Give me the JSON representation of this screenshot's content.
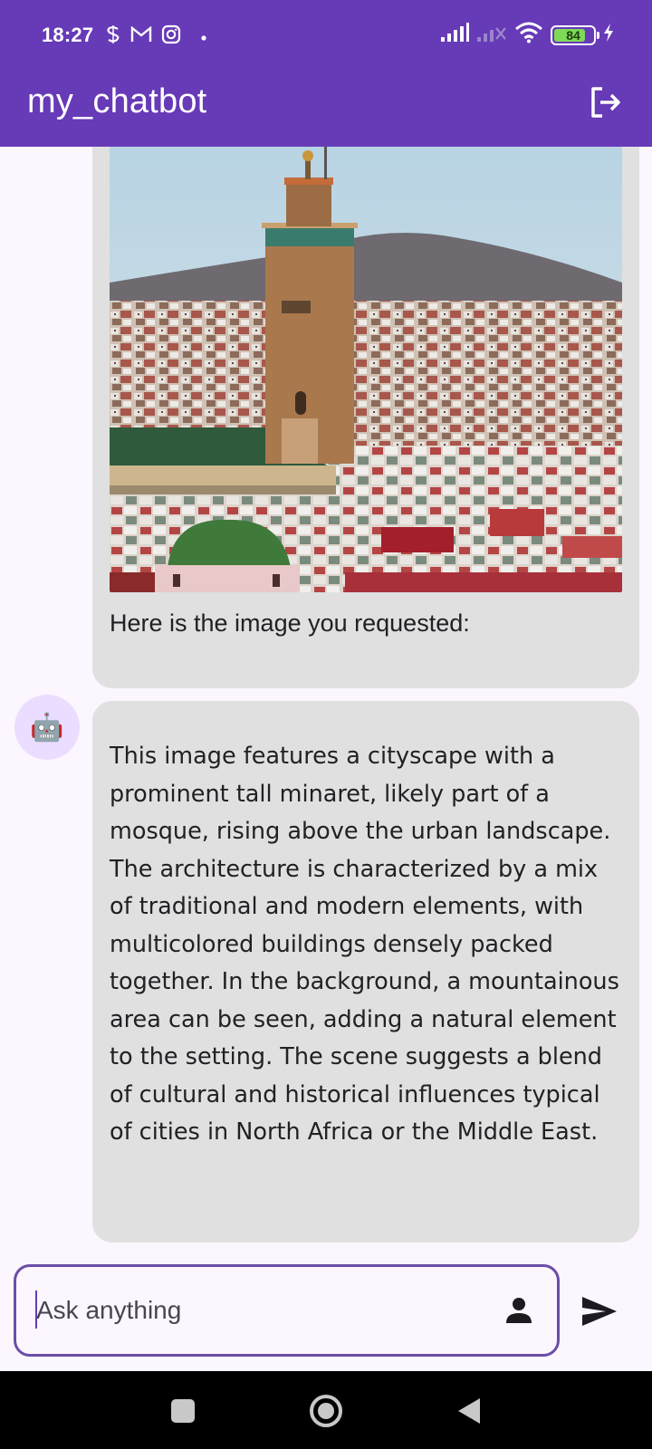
{
  "status_bar": {
    "time": "18:27",
    "battery_level": "84",
    "left_icons": [
      "s-icon",
      "gmail-icon",
      "instagram-icon",
      "dot-icon"
    ],
    "right_icons": [
      "signal-icon",
      "signal-off-icon",
      "wifi-icon",
      "battery-icon",
      "charging-icon"
    ]
  },
  "app_bar": {
    "title": "my_chatbot",
    "logout_icon": "logout-icon"
  },
  "messages": [
    {
      "role": "bot",
      "image": "generated-image",
      "caption": "Here is the image you requested:"
    },
    {
      "role": "bot",
      "avatar": "🤖",
      "text": "This image features a cityscape with a prominent tall minaret, likely part of a mosque, rising above the urban landscape. The architecture is characterized by a mix of traditional and modern elements, with multicolored buildings densely packed together. In the background, a mountainous area can be seen, adding a natural element to the setting. The scene suggests a blend of cultural and historical influences typical of cities in North Africa or the Middle East."
    }
  ],
  "input": {
    "placeholder": "Ask anything",
    "value": ""
  },
  "colors": {
    "primary": "#673ab7",
    "bubble": "#e0e0e0",
    "background": "#fcf6fe",
    "avatar_bg": "#eaddff"
  }
}
